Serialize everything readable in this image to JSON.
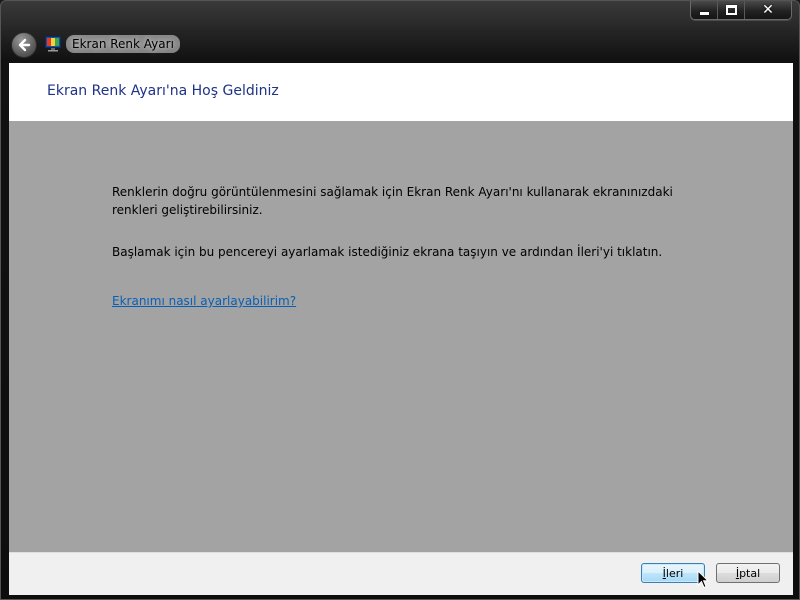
{
  "window": {
    "title": "Ekran Renk Ayarı",
    "close_glyph": "✕"
  },
  "header": {
    "heading": "Ekran Renk Ayarı'na Hoş Geldiniz"
  },
  "content": {
    "paragraph1": "Renklerin doğru görüntülenmesini sağlamak için Ekran Renk Ayarı'nı kullanarak ekranınızdaki renkleri geliştirebilirsiniz.",
    "paragraph2": "Başlamak için bu pencereyi ayarlamak istediğiniz ekrana taşıyın ve ardından İleri'yi tıklatın.",
    "help_link": "Ekranımı nasıl ayarlayabilirim?"
  },
  "footer": {
    "next_first": "İ",
    "next_rest": "leri",
    "cancel_first": "İ",
    "cancel_rest": "ptal"
  },
  "icons": {
    "back": "back-arrow-icon",
    "app": "monitor-color-icon",
    "minimize": "minimize-icon",
    "maximize": "maximize-icon",
    "close": "close-icon",
    "cursor": "mouse-cursor-icon"
  },
  "colors": {
    "heading": "#1e3287",
    "link": "#0a5fb4",
    "content_bg": "#a3a3a3",
    "next_border": "#3c7fb1"
  }
}
